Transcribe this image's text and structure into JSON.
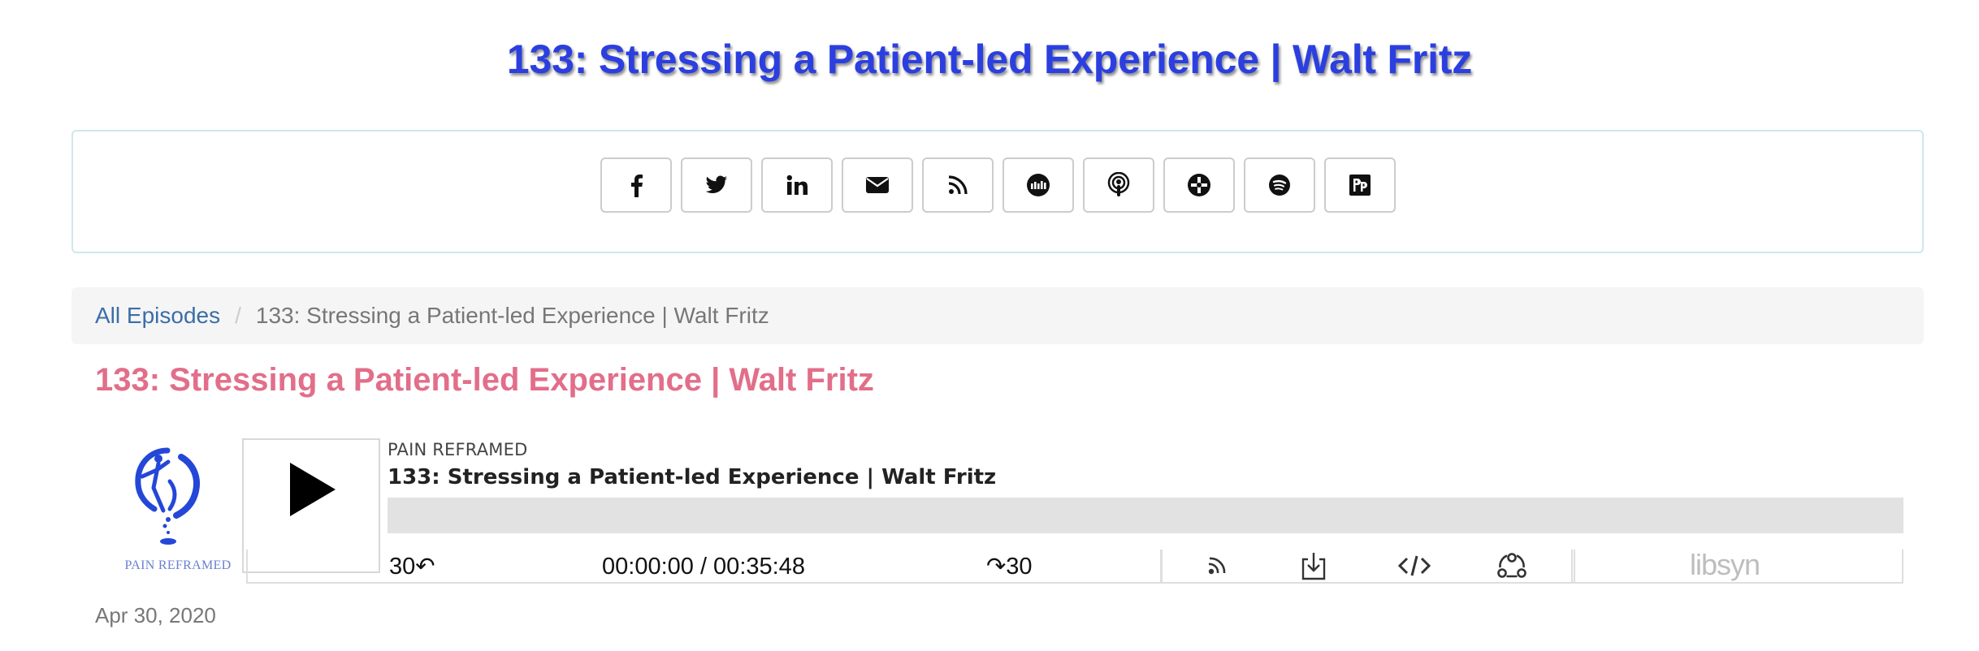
{
  "site": {
    "title": "133: Stressing a Patient-led Experience | Walt Fritz",
    "title_color": "#2b3fe0"
  },
  "share": {
    "buttons": [
      {
        "icon": "facebook-icon"
      },
      {
        "icon": "twitter-icon"
      },
      {
        "icon": "linkedin-icon"
      },
      {
        "icon": "email-icon"
      },
      {
        "icon": "rss-icon"
      },
      {
        "icon": "stitcher-icon"
      },
      {
        "icon": "apple-podcasts-icon"
      },
      {
        "icon": "google-podcasts-icon"
      },
      {
        "icon": "spotify-icon"
      },
      {
        "icon": "podchaser-icon"
      }
    ]
  },
  "breadcrumb": {
    "home_label": "All Episodes",
    "separator": "/",
    "current_label": "133: Stressing a Patient-led Experience | Walt Fritz"
  },
  "episode": {
    "title": "133: Stressing a Patient-led Experience | Walt Fritz",
    "title_color": "#e26e8a",
    "date": "Apr 30, 2020"
  },
  "player": {
    "logo_label": "PAIN REFRAMED",
    "show_name": "PAIN REFRAMED",
    "episode_title": "133: Stressing a Patient-led Experience | Walt Fritz",
    "progress": 0,
    "skip_back_label": "30↶",
    "time_label": "00:00:00 / 00:35:48",
    "skip_forward_label": "↷30",
    "icons": [
      "subscribe-icon",
      "download-icon",
      "embed-code-icon",
      "share-icon"
    ],
    "brand": "libsyn"
  }
}
